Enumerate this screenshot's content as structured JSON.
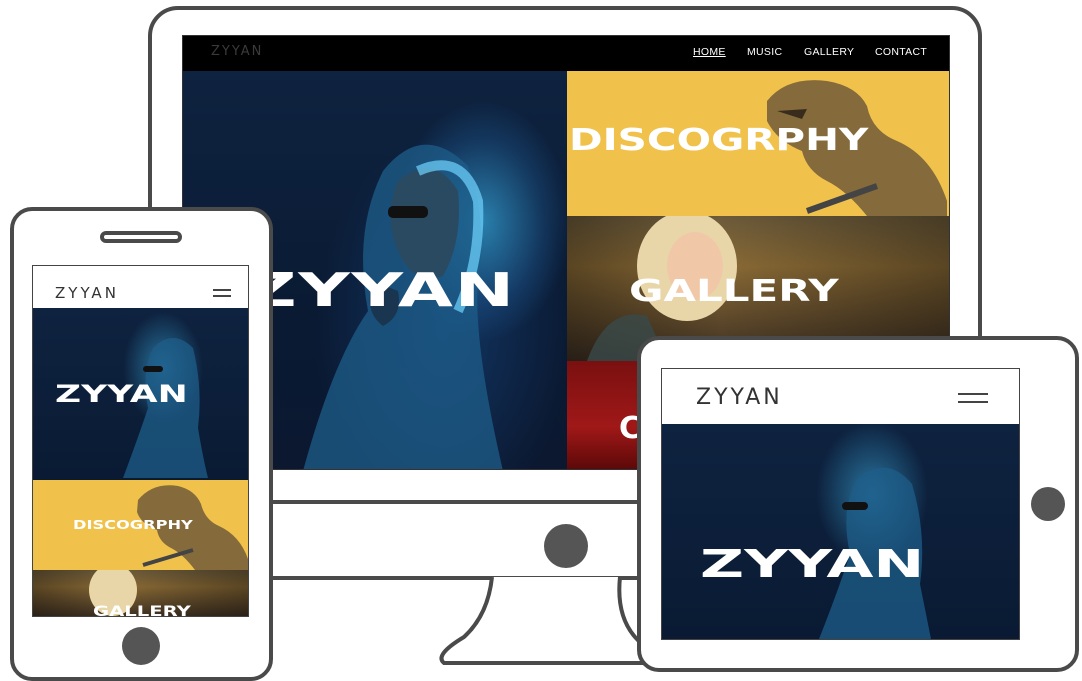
{
  "site": {
    "logo": "ZYYAN",
    "hero_title": "ZYYAN"
  },
  "desktop_nav": {
    "items": [
      {
        "label": "HOME",
        "active": true
      },
      {
        "label": "MUSIC",
        "active": false
      },
      {
        "label": "GALLERY",
        "active": false
      },
      {
        "label": "CONTACT",
        "active": false
      }
    ]
  },
  "panels": {
    "discography": "DISCOGRPHY",
    "gallery": "GALLERY",
    "third_partial": "C"
  },
  "icons": {
    "menu": "hamburger-menu-icon",
    "home_button": "device-home-button-icon"
  },
  "colors": {
    "nav_bg": "#000000",
    "hero_bg": "#0b1a33",
    "accent_yellow": "#f0c24c",
    "device_frame": "#4a4a4a"
  }
}
